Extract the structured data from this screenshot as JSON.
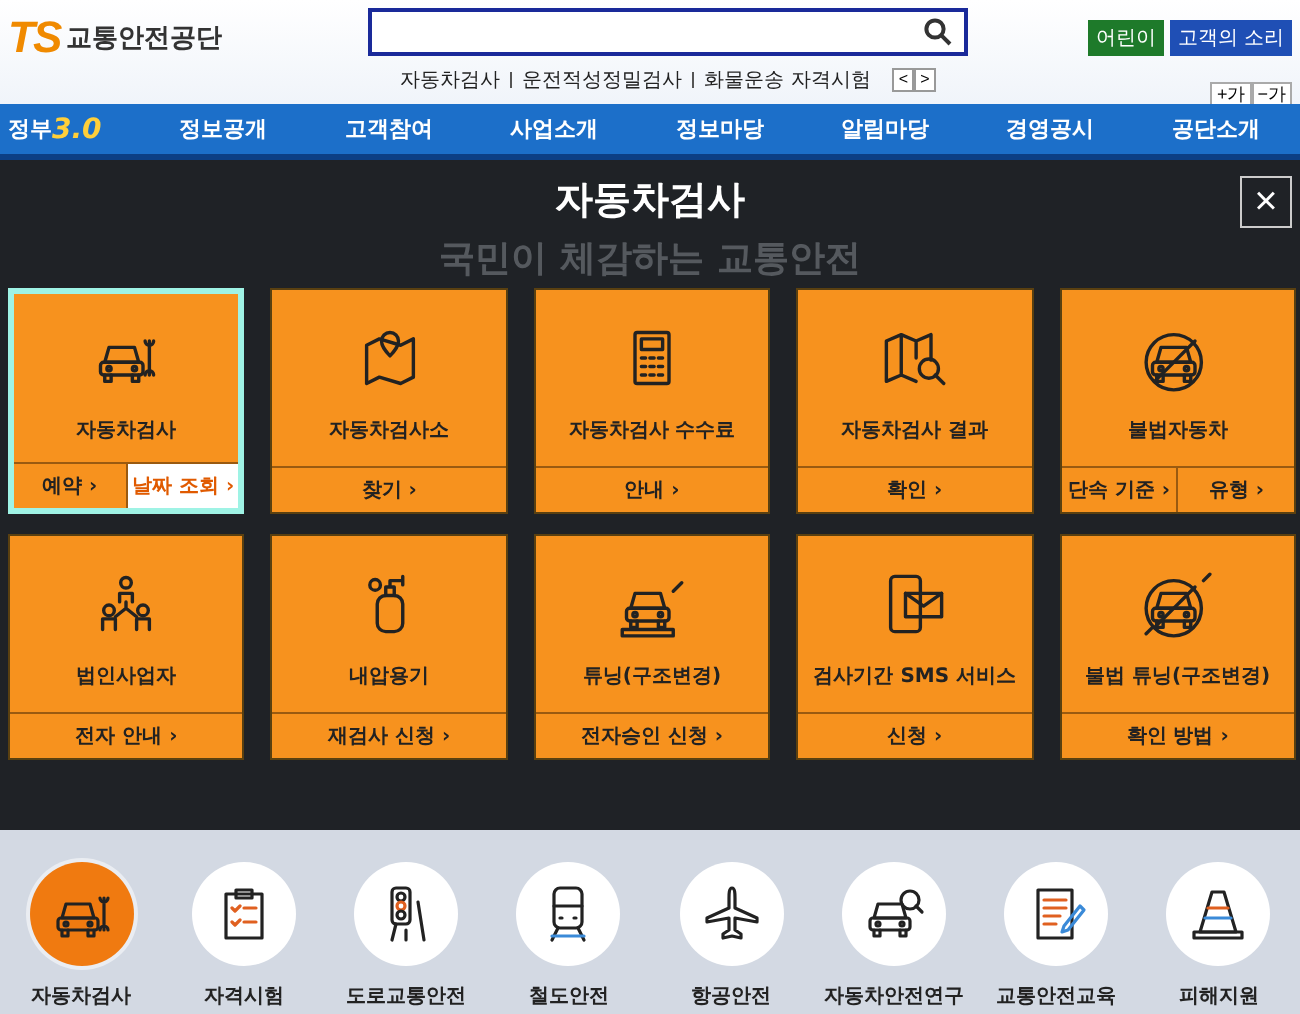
{
  "header": {
    "logo_mark": "TS",
    "logo_text": "교통안전공단",
    "quick_links": [
      "자동차검사",
      "운전적성정밀검사",
      "화물운송 자격시험"
    ],
    "pager": [
      "<",
      ">"
    ],
    "buttons": [
      {
        "label": "어린이",
        "color": "#1e7a2a"
      },
      {
        "label": "고객의 소리",
        "color": "#1f4fb5"
      }
    ],
    "font_size_buttons": [
      "+가",
      "−가"
    ]
  },
  "nav": {
    "badge_text": "정부",
    "badge_number": "3.0",
    "items": [
      "정보공개",
      "고객참여",
      "사업소개",
      "정보마당",
      "알림마당",
      "경영공시",
      "공단소개"
    ]
  },
  "panel": {
    "title": "자동차검사",
    "close": "×",
    "background_slogan": "국민이 체감하는 교통안전",
    "cards": [
      {
        "title": "자동차검사",
        "selected": true,
        "links": [
          {
            "label": "예약 ›",
            "highlighted": false
          },
          {
            "label": "날짜 조회 ›",
            "highlighted": true
          }
        ]
      },
      {
        "title": "자동차검사소",
        "selected": false,
        "links": [
          {
            "label": "찾기 ›",
            "highlighted": false
          }
        ]
      },
      {
        "title": "자동차검사 수수료",
        "selected": false,
        "links": [
          {
            "label": "안내 ›",
            "highlighted": false
          }
        ]
      },
      {
        "title": "자동차검사 결과",
        "selected": false,
        "links": [
          {
            "label": "확인 ›",
            "highlighted": false
          }
        ]
      },
      {
        "title": "불법자동차",
        "selected": false,
        "links": [
          {
            "label": "단속 기준 ›",
            "highlighted": false
          },
          {
            "label": "유형 ›",
            "highlighted": false
          }
        ]
      },
      {
        "title": "법인사업자",
        "selected": false,
        "links": [
          {
            "label": "전자 안내 ›",
            "highlighted": false
          }
        ]
      },
      {
        "title": "내압용기",
        "selected": false,
        "links": [
          {
            "label": "재검사 신청 ›",
            "highlighted": false
          }
        ]
      },
      {
        "title": "튜닝(구조변경)",
        "selected": false,
        "links": [
          {
            "label": "전자승인 신청 ›",
            "highlighted": false
          }
        ]
      },
      {
        "title": "검사기간 SMS 서비스",
        "selected": false,
        "links": [
          {
            "label": "신청 ›",
            "highlighted": false
          }
        ]
      },
      {
        "title": "불법 튜닝(구조변경)",
        "selected": false,
        "links": [
          {
            "label": "확인 방법 ›",
            "highlighted": false
          }
        ]
      }
    ]
  },
  "categories": [
    {
      "label": "자동차검사",
      "selected": true
    },
    {
      "label": "자격시험",
      "selected": false
    },
    {
      "label": "도로교통안전",
      "selected": false
    },
    {
      "label": "철도안전",
      "selected": false
    },
    {
      "label": "항공안전",
      "selected": false
    },
    {
      "label": "자동차안전연구",
      "selected": false
    },
    {
      "label": "교통안전교육",
      "selected": false
    },
    {
      "label": "피해지원",
      "selected": false
    }
  ]
}
